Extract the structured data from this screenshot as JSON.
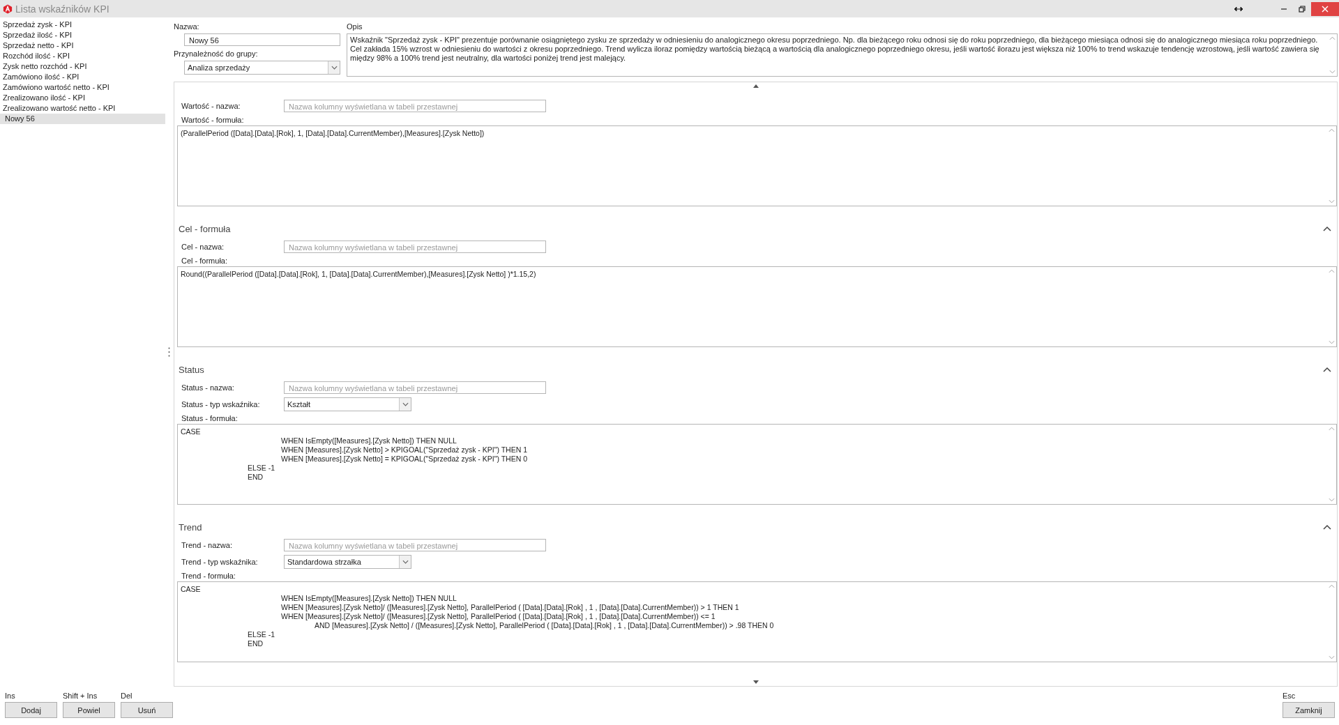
{
  "window": {
    "title": "Lista wskaźników KPI"
  },
  "kpi_list": [
    {
      "label": "Sprzedaż zysk - KPI",
      "selected": false
    },
    {
      "label": "Sprzedaż ilość - KPI",
      "selected": false
    },
    {
      "label": "Sprzedaż netto - KPI",
      "selected": false
    },
    {
      "label": "Rozchód ilość - KPI",
      "selected": false
    },
    {
      "label": "Zysk netto rozchód - KPI",
      "selected": false
    },
    {
      "label": "Zamówiono ilość - KPI",
      "selected": false
    },
    {
      "label": "Zamówiono wartość netto - KPI",
      "selected": false
    },
    {
      "label": "Zrealizowano ilość - KPI",
      "selected": false
    },
    {
      "label": "Zrealizowano wartość netto - KPI",
      "selected": false
    },
    {
      "label": "Nowy 56",
      "selected": true
    }
  ],
  "form": {
    "name_label": "Nazwa:",
    "name_value": "Nowy 56",
    "group_label": "Przynależność do grupy:",
    "group_value": "Analiza sprzedaży",
    "description_label": "Opis",
    "description": "Wskaźnik \"Sprzedaż zysk - KPI\" prezentuje porównanie osiągniętego zysku ze sprzedaży w odniesieniu do analogicznego okresu poprzedniego. Np. dla bieżącego roku odnosi się do roku poprzedniego, dla bieżącego miesiąca odnosi się do analogicznego miesiąca roku poprzedniego. Cel zakłada 15% wzrost w odniesieniu do wartości z okresu poprzedniego. Trend wylicza iloraz pomiędzy wartością bieżącą a wartością dla analogicznego poprzedniego okresu, jeśli wartość ilorazu jest większa niż 100% to trend wskazuje tendencję wzrostową, jeśli wartość zawiera się między 98% a 100% trend jest neutralny, dla wartości poniżej trend jest malejący."
  },
  "sections": [
    {
      "name_label": "Wartość - nazwa:",
      "name_placeholder": "Nazwa kolumny wyświetlana w tabeli przestawnej",
      "formula_label": "Wartość - formuła:",
      "formula": "(ParallelPeriod ([Data].[Data].[Rok], 1, [Data].[Data].CurrentMember),[Measures].[Zysk Netto])"
    },
    {
      "title": "Cel - formuła",
      "expanded": true,
      "name_label": "Cel - nazwa:",
      "name_placeholder": "Nazwa kolumny wyświetlana w tabeli przestawnej",
      "formula_label": "Cel - formuła:",
      "formula": "Round((ParallelPeriod ([Data].[Data].[Rok], 1, [Data].[Data].CurrentMember),[Measures].[Zysk Netto] )*1.15,2)"
    },
    {
      "title": "Status",
      "expanded": true,
      "name_label": "Status - nazwa:",
      "name_placeholder": "Nazwa kolumny wyświetlana w tabeli przestawnej",
      "type_label": "Status - typ wskaźnika:",
      "type_value": "Kształt",
      "formula_label": "Status - formuła:",
      "formula": "CASE\n\t\t\tWHEN IsEmpty([Measures].[Zysk Netto]) THEN NULL\n\t\t\tWHEN [Measures].[Zysk Netto] > KPIGOAL(\"Sprzedaż zysk - KPI\") THEN 1\n\t\t\tWHEN [Measures].[Zysk Netto] = KPIGOAL(\"Sprzedaż zysk - KPI\") THEN 0\n\t\tELSE -1\n\t\tEND"
    },
    {
      "title": "Trend",
      "expanded": true,
      "name_label": "Trend - nazwa:",
      "name_placeholder": "Nazwa kolumny wyświetlana w tabeli przestawnej",
      "type_label": "Trend - typ wskaźnika:",
      "type_value": "Standardowa strzałka",
      "formula_label": "Trend - formuła:",
      "formula": "CASE\n\t\t\tWHEN IsEmpty([Measures].[Zysk Netto]) THEN NULL\n\t\t\tWHEN [Measures].[Zysk Netto]/ ([Measures].[Zysk Netto], ParallelPeriod ( [Data].[Data].[Rok] , 1 , [Data].[Data].CurrentMember)) > 1 THEN 1\n\t\t\tWHEN [Measures].[Zysk Netto]/ ([Measures].[Zysk Netto], ParallelPeriod ( [Data].[Data].[Rok] , 1 , [Data].[Data].CurrentMember)) <= 1\n\t\t\t\tAND [Measures].[Zysk Netto] / ([Measures].[Zysk Netto], ParallelPeriod ( [Data].[Data].[Rok] , 1 , [Data].[Data].CurrentMember)) > .98 THEN 0\n\t\tELSE -1\n\t\tEND"
    }
  ],
  "actions": [
    {
      "key": "Ins",
      "label": "Dodaj"
    },
    {
      "key": "Shift + Ins",
      "label": "Powiel"
    },
    {
      "key": "Del",
      "label": "Usuń"
    }
  ],
  "close": {
    "key": "Esc",
    "label": "Zamknij"
  }
}
